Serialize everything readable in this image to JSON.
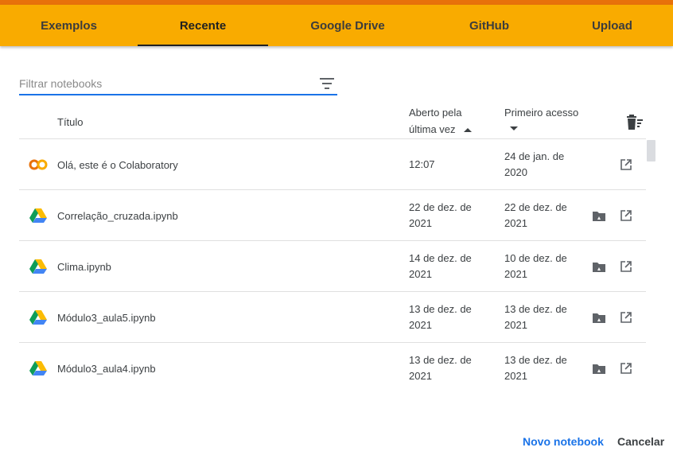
{
  "tabs": [
    {
      "label": "Exemplos",
      "active": false
    },
    {
      "label": "Recente",
      "active": true
    },
    {
      "label": "Google Drive",
      "active": false
    },
    {
      "label": "GitHub",
      "active": false
    },
    {
      "label": "Upload",
      "active": false
    }
  ],
  "filter": {
    "placeholder": "Filtrar notebooks",
    "value": ""
  },
  "table": {
    "headers": {
      "title": "Título",
      "opened_line1": "Aberto pela",
      "opened_line2": "última vez",
      "first_access": "Primeiro acesso"
    },
    "rows": [
      {
        "icon": "colab-logo-icon",
        "title": "Olá, este é o Colaboratory",
        "opened_1": "12:07",
        "opened_2": "",
        "first_1": "24 de jan. de",
        "first_2": "2020",
        "has_drive_folder": false
      },
      {
        "icon": "google-drive-icon",
        "title": "Correlação_cruzada.ipynb",
        "opened_1": "22 de dez. de",
        "opened_2": "2021",
        "first_1": "22 de dez. de",
        "first_2": "2021",
        "has_drive_folder": true
      },
      {
        "icon": "google-drive-icon",
        "title": "Clima.ipynb",
        "opened_1": "14 de dez. de",
        "opened_2": "2021",
        "first_1": "10 de dez. de",
        "first_2": "2021",
        "has_drive_folder": true
      },
      {
        "icon": "google-drive-icon",
        "title": "Módulo3_aula5.ipynb",
        "opened_1": "13 de dez. de",
        "opened_2": "2021",
        "first_1": "13 de dez. de",
        "first_2": "2021",
        "has_drive_folder": true
      },
      {
        "icon": "google-drive-icon",
        "title": "Módulo3_aula4.ipynb",
        "opened_1": "13 de dez. de",
        "opened_2": "2021",
        "first_1": "13 de dez. de",
        "first_2": "2021",
        "has_drive_folder": true
      }
    ]
  },
  "footer": {
    "new_notebook": "Novo notebook",
    "cancel": "Cancelar"
  },
  "colors": {
    "tabbar": "#f9ab00",
    "top_strip": "#e8710a",
    "accent": "#1a73e8"
  }
}
